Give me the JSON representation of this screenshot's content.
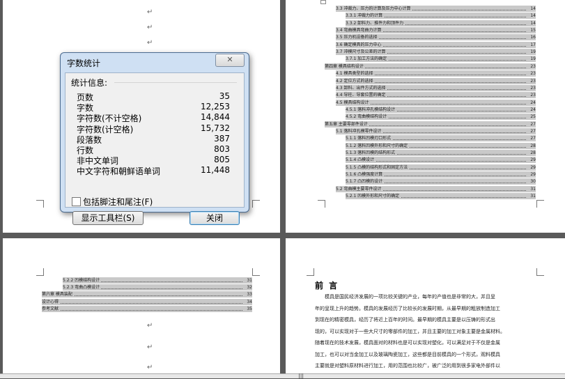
{
  "pilcrow": "↵",
  "dialog": {
    "title": "字数统计",
    "close_glyph": "✕",
    "section": "统计信息:",
    "stats": [
      {
        "label": "页数",
        "value": "35"
      },
      {
        "label": "字数",
        "value": "12,253"
      },
      {
        "label": "字符数(不计空格)",
        "value": "14,844"
      },
      {
        "label": "字符数(计空格)",
        "value": "15,732"
      },
      {
        "label": "段落数",
        "value": "387"
      },
      {
        "label": "行数",
        "value": "803"
      },
      {
        "label": "非中文单词",
        "value": "805"
      },
      {
        "label": "中文字符和朝鲜语单词",
        "value": "11,448"
      }
    ],
    "checkbox_label": "包括脚注和尾注(F)",
    "toolbar_button": "显示工具栏(S)",
    "close_button": "关闭"
  },
  "toc_page2": [
    {
      "text": "3.3 冲裁力、压力的计算及压力中心计算",
      "page": "14",
      "level": 1
    },
    {
      "text": "3.3.1 冲裁力的计算",
      "page": "14",
      "level": 2
    },
    {
      "text": "3.3.2 卸料力、推件力和顶件力",
      "page": "14",
      "level": 2
    },
    {
      "text": "3.4 弯曲模具弯曲力计算",
      "page": "15",
      "level": 1
    },
    {
      "text": "3.5 压力机设备的选择",
      "page": "16",
      "level": 1
    },
    {
      "text": "3.6 确定模具的压力中心",
      "page": "17",
      "level": 1
    },
    {
      "text": "3.7 冲模尺寸及公差的计算",
      "page": "19",
      "level": 1
    },
    {
      "text": "3.7.1 加工方法的确定",
      "page": "19",
      "level": 2
    },
    {
      "text": "第四章 模具结构设计",
      "page": "23",
      "level": 0
    },
    {
      "text": "4.1 模具类型的选择",
      "page": "23",
      "level": 1
    },
    {
      "text": "4.2 定位方式的选择",
      "page": "23",
      "level": 1
    },
    {
      "text": "4.3 卸料、出件方式的选择",
      "page": "23",
      "level": 1
    },
    {
      "text": "4.4 导柱、导套位置的确定",
      "page": "23",
      "level": 1
    },
    {
      "text": "4.5 模具结构设计",
      "page": "24",
      "level": 1
    },
    {
      "text": "4.5.1 落料冲孔模结构设计",
      "page": "24",
      "level": 2
    },
    {
      "text": "4.5.2 弯曲模结构设计",
      "page": "25",
      "level": 2
    },
    {
      "text": "第五章 主要零部件设计",
      "page": "27",
      "level": 0
    },
    {
      "text": "5.1 落料冲孔模零件设计",
      "page": "27",
      "level": 1
    },
    {
      "text": "5.1.1 落料凹模刃口形式",
      "page": "27",
      "level": 2
    },
    {
      "text": "5.1.2 落料凹模外形和尺寸的确定",
      "page": "28",
      "level": 2
    },
    {
      "text": "5.1.3 落料凹模的结构形式",
      "page": "28",
      "level": 2
    },
    {
      "text": "5.1.4 凸模设计",
      "page": "29",
      "level": 2
    },
    {
      "text": "5.1.5 凸模的结构形式和固定方法",
      "page": "29",
      "level": 2
    },
    {
      "text": "5.1.6 凸模强度计算",
      "page": "29",
      "level": 2
    },
    {
      "text": "5.1.7 凸凹模的设计",
      "page": "30",
      "level": 2
    },
    {
      "text": "5.2 弯曲模主要零件设计",
      "page": "31",
      "level": 1
    },
    {
      "text": "5.2.1 凹模外形和尺寸的确定",
      "page": "31",
      "level": 2
    }
  ],
  "toc_page3": [
    {
      "text": "5.2.2 凹模结构设计",
      "page": "31",
      "level": 2
    },
    {
      "text": "5.2.3 弯曲凸模设计",
      "page": "32",
      "level": 2
    },
    {
      "text": "第六章 模具装配",
      "page": "33",
      "level": 0
    },
    {
      "text": "设计心得",
      "page": "34",
      "level": 0
    },
    {
      "text": "参考文献",
      "page": "35",
      "level": 0
    }
  ],
  "page4": {
    "title": "前  言",
    "lines": [
      "模具是国民经济发展的一项比较关键的产业，每年的产值也是非常的大，并且呈",
      "年的呈现上升的趋势。模具的发展经历了比较长的发展时期，从最早期的粗放制造加工",
      "到现在的精密模具，经历了将近上百年的时间。最早期的模具主要是以压铸的形式出",
      "现的，可以实现对于一些大尺寸的零部件的加工，并且主要的加工对象主要是金属材料。",
      "随着现在的技术发展，模具面对的材料也是可以实现对塑化，可以满足对于不仅是金属",
      "加工，也可以对当金加工以及玻璃陶瓷加工，这些都是目前模具的一个形式，观料模具",
      "主要就是对塑料原材料进行加工，用的范围也比较广，被广泛的用到很多家电外部件以"
    ]
  }
}
